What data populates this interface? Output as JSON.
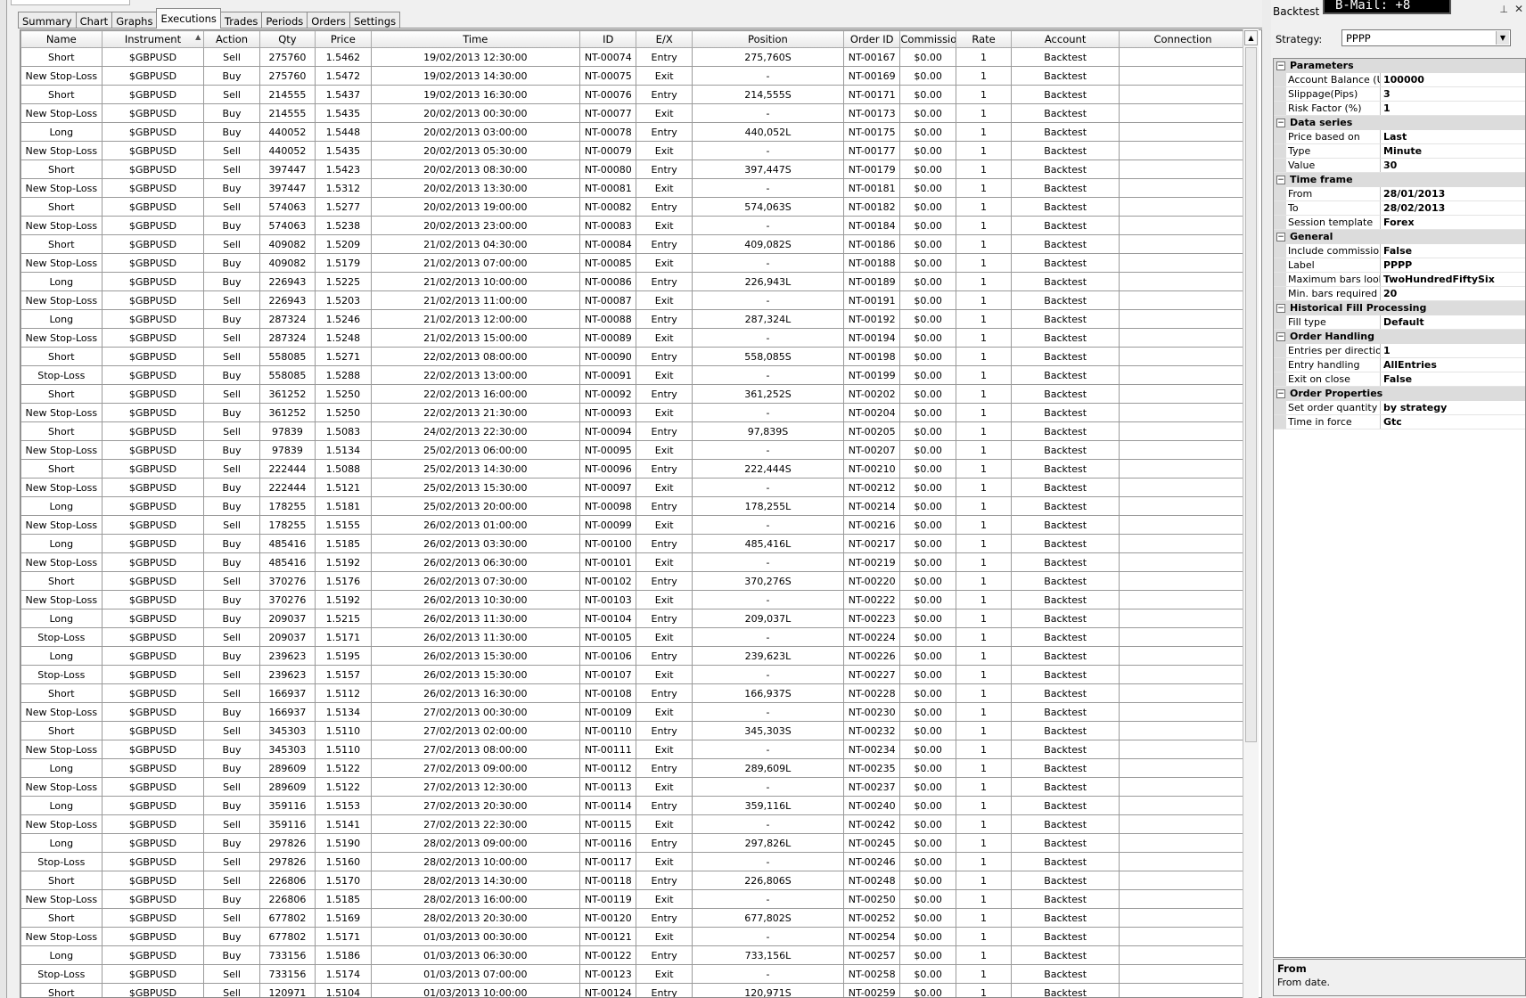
{
  "tabs": [
    "Summary",
    "Chart",
    "Graphs",
    "Executions",
    "Trades",
    "Periods",
    "Orders",
    "Settings"
  ],
  "active_tab": "Executions",
  "columns": [
    {
      "label": "Name",
      "w": 90
    },
    {
      "label": "Instrument",
      "w": 114
    },
    {
      "label": "Action",
      "w": 62
    },
    {
      "label": "Qty",
      "w": 62
    },
    {
      "label": "Price",
      "w": 62
    },
    {
      "label": "Time",
      "w": 233
    },
    {
      "label": "ID",
      "w": 63
    },
    {
      "label": "E/X",
      "w": 62
    },
    {
      "label": "Position",
      "w": 169
    },
    {
      "label": "Order ID",
      "w": 63
    },
    {
      "label": "Commissio",
      "w": 62
    },
    {
      "label": "Rate",
      "w": 62
    },
    {
      "label": "Account",
      "w": 120
    },
    {
      "label": "Connection",
      "w": 142
    }
  ],
  "rows": [
    [
      "Short",
      "$GBPUSD",
      "Sell",
      "275760",
      "1.5462",
      "19/02/2013 12:30:00",
      "NT-00074",
      "Entry",
      "275,760S",
      "NT-00167",
      "$0.00",
      "1",
      "Backtest",
      ""
    ],
    [
      "New Stop-Loss",
      "$GBPUSD",
      "Buy",
      "275760",
      "1.5472",
      "19/02/2013 14:30:00",
      "NT-00075",
      "Exit",
      "-",
      "NT-00169",
      "$0.00",
      "1",
      "Backtest",
      ""
    ],
    [
      "Short",
      "$GBPUSD",
      "Sell",
      "214555",
      "1.5437",
      "19/02/2013 16:30:00",
      "NT-00076",
      "Entry",
      "214,555S",
      "NT-00171",
      "$0.00",
      "1",
      "Backtest",
      ""
    ],
    [
      "New Stop-Loss",
      "$GBPUSD",
      "Buy",
      "214555",
      "1.5435",
      "20/02/2013 00:30:00",
      "NT-00077",
      "Exit",
      "-",
      "NT-00173",
      "$0.00",
      "1",
      "Backtest",
      ""
    ],
    [
      "Long",
      "$GBPUSD",
      "Buy",
      "440052",
      "1.5448",
      "20/02/2013 03:00:00",
      "NT-00078",
      "Entry",
      "440,052L",
      "NT-00175",
      "$0.00",
      "1",
      "Backtest",
      ""
    ],
    [
      "New Stop-Loss",
      "$GBPUSD",
      "Sell",
      "440052",
      "1.5435",
      "20/02/2013 05:30:00",
      "NT-00079",
      "Exit",
      "-",
      "NT-00177",
      "$0.00",
      "1",
      "Backtest",
      ""
    ],
    [
      "Short",
      "$GBPUSD",
      "Sell",
      "397447",
      "1.5423",
      "20/02/2013 08:30:00",
      "NT-00080",
      "Entry",
      "397,447S",
      "NT-00179",
      "$0.00",
      "1",
      "Backtest",
      ""
    ],
    [
      "New Stop-Loss",
      "$GBPUSD",
      "Buy",
      "397447",
      "1.5312",
      "20/02/2013 13:30:00",
      "NT-00081",
      "Exit",
      "-",
      "NT-00181",
      "$0.00",
      "1",
      "Backtest",
      ""
    ],
    [
      "Short",
      "$GBPUSD",
      "Sell",
      "574063",
      "1.5277",
      "20/02/2013 19:00:00",
      "NT-00082",
      "Entry",
      "574,063S",
      "NT-00182",
      "$0.00",
      "1",
      "Backtest",
      ""
    ],
    [
      "New Stop-Loss",
      "$GBPUSD",
      "Buy",
      "574063",
      "1.5238",
      "20/02/2013 23:00:00",
      "NT-00083",
      "Exit",
      "-",
      "NT-00184",
      "$0.00",
      "1",
      "Backtest",
      ""
    ],
    [
      "Short",
      "$GBPUSD",
      "Sell",
      "409082",
      "1.5209",
      "21/02/2013 04:30:00",
      "NT-00084",
      "Entry",
      "409,082S",
      "NT-00186",
      "$0.00",
      "1",
      "Backtest",
      ""
    ],
    [
      "New Stop-Loss",
      "$GBPUSD",
      "Buy",
      "409082",
      "1.5179",
      "21/02/2013 07:00:00",
      "NT-00085",
      "Exit",
      "-",
      "NT-00188",
      "$0.00",
      "1",
      "Backtest",
      ""
    ],
    [
      "Long",
      "$GBPUSD",
      "Buy",
      "226943",
      "1.5225",
      "21/02/2013 10:00:00",
      "NT-00086",
      "Entry",
      "226,943L",
      "NT-00189",
      "$0.00",
      "1",
      "Backtest",
      ""
    ],
    [
      "New Stop-Loss",
      "$GBPUSD",
      "Sell",
      "226943",
      "1.5203",
      "21/02/2013 11:00:00",
      "NT-00087",
      "Exit",
      "-",
      "NT-00191",
      "$0.00",
      "1",
      "Backtest",
      ""
    ],
    [
      "Long",
      "$GBPUSD",
      "Buy",
      "287324",
      "1.5246",
      "21/02/2013 12:00:00",
      "NT-00088",
      "Entry",
      "287,324L",
      "NT-00192",
      "$0.00",
      "1",
      "Backtest",
      ""
    ],
    [
      "New Stop-Loss",
      "$GBPUSD",
      "Sell",
      "287324",
      "1.5248",
      "21/02/2013 15:00:00",
      "NT-00089",
      "Exit",
      "-",
      "NT-00194",
      "$0.00",
      "1",
      "Backtest",
      ""
    ],
    [
      "Short",
      "$GBPUSD",
      "Sell",
      "558085",
      "1.5271",
      "22/02/2013 08:00:00",
      "NT-00090",
      "Entry",
      "558,085S",
      "NT-00198",
      "$0.00",
      "1",
      "Backtest",
      ""
    ],
    [
      "Stop-Loss",
      "$GBPUSD",
      "Buy",
      "558085",
      "1.5288",
      "22/02/2013 13:00:00",
      "NT-00091",
      "Exit",
      "-",
      "NT-00199",
      "$0.00",
      "1",
      "Backtest",
      ""
    ],
    [
      "Short",
      "$GBPUSD",
      "Sell",
      "361252",
      "1.5250",
      "22/02/2013 16:00:00",
      "NT-00092",
      "Entry",
      "361,252S",
      "NT-00202",
      "$0.00",
      "1",
      "Backtest",
      ""
    ],
    [
      "New Stop-Loss",
      "$GBPUSD",
      "Buy",
      "361252",
      "1.5250",
      "22/02/2013 21:30:00",
      "NT-00093",
      "Exit",
      "-",
      "NT-00204",
      "$0.00",
      "1",
      "Backtest",
      ""
    ],
    [
      "Short",
      "$GBPUSD",
      "Sell",
      "97839",
      "1.5083",
      "24/02/2013 22:30:00",
      "NT-00094",
      "Entry",
      "97,839S",
      "NT-00205",
      "$0.00",
      "1",
      "Backtest",
      ""
    ],
    [
      "New Stop-Loss",
      "$GBPUSD",
      "Buy",
      "97839",
      "1.5134",
      "25/02/2013 06:00:00",
      "NT-00095",
      "Exit",
      "-",
      "NT-00207",
      "$0.00",
      "1",
      "Backtest",
      ""
    ],
    [
      "Short",
      "$GBPUSD",
      "Sell",
      "222444",
      "1.5088",
      "25/02/2013 14:30:00",
      "NT-00096",
      "Entry",
      "222,444S",
      "NT-00210",
      "$0.00",
      "1",
      "Backtest",
      ""
    ],
    [
      "New Stop-Loss",
      "$GBPUSD",
      "Buy",
      "222444",
      "1.5121",
      "25/02/2013 15:30:00",
      "NT-00097",
      "Exit",
      "-",
      "NT-00212",
      "$0.00",
      "1",
      "Backtest",
      ""
    ],
    [
      "Long",
      "$GBPUSD",
      "Buy",
      "178255",
      "1.5181",
      "25/02/2013 20:00:00",
      "NT-00098",
      "Entry",
      "178,255L",
      "NT-00214",
      "$0.00",
      "1",
      "Backtest",
      ""
    ],
    [
      "New Stop-Loss",
      "$GBPUSD",
      "Sell",
      "178255",
      "1.5155",
      "26/02/2013 01:00:00",
      "NT-00099",
      "Exit",
      "-",
      "NT-00216",
      "$0.00",
      "1",
      "Backtest",
      ""
    ],
    [
      "Long",
      "$GBPUSD",
      "Buy",
      "485416",
      "1.5185",
      "26/02/2013 03:30:00",
      "NT-00100",
      "Entry",
      "485,416L",
      "NT-00217",
      "$0.00",
      "1",
      "Backtest",
      ""
    ],
    [
      "New Stop-Loss",
      "$GBPUSD",
      "Buy",
      "485416",
      "1.5192",
      "26/02/2013 06:30:00",
      "NT-00101",
      "Exit",
      "-",
      "NT-00219",
      "$0.00",
      "1",
      "Backtest",
      ""
    ],
    [
      "Short",
      "$GBPUSD",
      "Sell",
      "370276",
      "1.5176",
      "26/02/2013 07:30:00",
      "NT-00102",
      "Entry",
      "370,276S",
      "NT-00220",
      "$0.00",
      "1",
      "Backtest",
      ""
    ],
    [
      "New Stop-Loss",
      "$GBPUSD",
      "Buy",
      "370276",
      "1.5192",
      "26/02/2013 10:30:00",
      "NT-00103",
      "Exit",
      "-",
      "NT-00222",
      "$0.00",
      "1",
      "Backtest",
      ""
    ],
    [
      "Long",
      "$GBPUSD",
      "Buy",
      "209037",
      "1.5215",
      "26/02/2013 11:30:00",
      "NT-00104",
      "Entry",
      "209,037L",
      "NT-00223",
      "$0.00",
      "1",
      "Backtest",
      ""
    ],
    [
      "Stop-Loss",
      "$GBPUSD",
      "Sell",
      "209037",
      "1.5171",
      "26/02/2013 11:30:00",
      "NT-00105",
      "Exit",
      "-",
      "NT-00224",
      "$0.00",
      "1",
      "Backtest",
      ""
    ],
    [
      "Long",
      "$GBPUSD",
      "Buy",
      "239623",
      "1.5195",
      "26/02/2013 15:30:00",
      "NT-00106",
      "Entry",
      "239,623L",
      "NT-00226",
      "$0.00",
      "1",
      "Backtest",
      ""
    ],
    [
      "Stop-Loss",
      "$GBPUSD",
      "Sell",
      "239623",
      "1.5157",
      "26/02/2013 15:30:00",
      "NT-00107",
      "Exit",
      "-",
      "NT-00227",
      "$0.00",
      "1",
      "Backtest",
      ""
    ],
    [
      "Short",
      "$GBPUSD",
      "Sell",
      "166937",
      "1.5112",
      "26/02/2013 16:30:00",
      "NT-00108",
      "Entry",
      "166,937S",
      "NT-00228",
      "$0.00",
      "1",
      "Backtest",
      ""
    ],
    [
      "New Stop-Loss",
      "$GBPUSD",
      "Buy",
      "166937",
      "1.5134",
      "27/02/2013 00:30:00",
      "NT-00109",
      "Exit",
      "-",
      "NT-00230",
      "$0.00",
      "1",
      "Backtest",
      ""
    ],
    [
      "Short",
      "$GBPUSD",
      "Sell",
      "345303",
      "1.5110",
      "27/02/2013 02:00:00",
      "NT-00110",
      "Entry",
      "345,303S",
      "NT-00232",
      "$0.00",
      "1",
      "Backtest",
      ""
    ],
    [
      "New Stop-Loss",
      "$GBPUSD",
      "Buy",
      "345303",
      "1.5110",
      "27/02/2013 08:00:00",
      "NT-00111",
      "Exit",
      "-",
      "NT-00234",
      "$0.00",
      "1",
      "Backtest",
      ""
    ],
    [
      "Long",
      "$GBPUSD",
      "Buy",
      "289609",
      "1.5122",
      "27/02/2013 09:00:00",
      "NT-00112",
      "Entry",
      "289,609L",
      "NT-00235",
      "$0.00",
      "1",
      "Backtest",
      ""
    ],
    [
      "New Stop-Loss",
      "$GBPUSD",
      "Sell",
      "289609",
      "1.5122",
      "27/02/2013 12:30:00",
      "NT-00113",
      "Exit",
      "-",
      "NT-00237",
      "$0.00",
      "1",
      "Backtest",
      ""
    ],
    [
      "Long",
      "$GBPUSD",
      "Buy",
      "359116",
      "1.5153",
      "27/02/2013 20:30:00",
      "NT-00114",
      "Entry",
      "359,116L",
      "NT-00240",
      "$0.00",
      "1",
      "Backtest",
      ""
    ],
    [
      "New Stop-Loss",
      "$GBPUSD",
      "Sell",
      "359116",
      "1.5141",
      "27/02/2013 22:30:00",
      "NT-00115",
      "Exit",
      "-",
      "NT-00242",
      "$0.00",
      "1",
      "Backtest",
      ""
    ],
    [
      "Long",
      "$GBPUSD",
      "Buy",
      "297826",
      "1.5190",
      "28/02/2013 09:00:00",
      "NT-00116",
      "Entry",
      "297,826L",
      "NT-00245",
      "$0.00",
      "1",
      "Backtest",
      ""
    ],
    [
      "Stop-Loss",
      "$GBPUSD",
      "Sell",
      "297826",
      "1.5160",
      "28/02/2013 10:00:00",
      "NT-00117",
      "Exit",
      "-",
      "NT-00246",
      "$0.00",
      "1",
      "Backtest",
      ""
    ],
    [
      "Short",
      "$GBPUSD",
      "Sell",
      "226806",
      "1.5170",
      "28/02/2013 14:30:00",
      "NT-00118",
      "Entry",
      "226,806S",
      "NT-00248",
      "$0.00",
      "1",
      "Backtest",
      ""
    ],
    [
      "New Stop-Loss",
      "$GBPUSD",
      "Buy",
      "226806",
      "1.5185",
      "28/02/2013 16:00:00",
      "NT-00119",
      "Exit",
      "-",
      "NT-00250",
      "$0.00",
      "1",
      "Backtest",
      ""
    ],
    [
      "Short",
      "$GBPUSD",
      "Sell",
      "677802",
      "1.5169",
      "28/02/2013 20:30:00",
      "NT-00120",
      "Entry",
      "677,802S",
      "NT-00252",
      "$0.00",
      "1",
      "Backtest",
      ""
    ],
    [
      "New Stop-Loss",
      "$GBPUSD",
      "Buy",
      "677802",
      "1.5171",
      "01/03/2013 00:30:00",
      "NT-00121",
      "Exit",
      "-",
      "NT-00254",
      "$0.00",
      "1",
      "Backtest",
      ""
    ],
    [
      "Long",
      "$GBPUSD",
      "Buy",
      "733156",
      "1.5186",
      "01/03/2013 06:30:00",
      "NT-00122",
      "Entry",
      "733,156L",
      "NT-00257",
      "$0.00",
      "1",
      "Backtest",
      ""
    ],
    [
      "Stop-Loss",
      "$GBPUSD",
      "Sell",
      "733156",
      "1.5174",
      "01/03/2013 07:00:00",
      "NT-00123",
      "Exit",
      "-",
      "NT-00258",
      "$0.00",
      "1",
      "Backtest",
      ""
    ],
    [
      "Short",
      "$GBPUSD",
      "Sell",
      "120971",
      "1.5104",
      "01/03/2013 10:00:00",
      "NT-00124",
      "Entry",
      "120,971S",
      "NT-00259",
      "$0.00",
      "1",
      "Backtest",
      ""
    ]
  ],
  "panel": {
    "title": "Backtest",
    "bmail": "B-Mail: +8",
    "strategy_label": "Strategy:",
    "strategy_value": "PPPP",
    "categories": [
      {
        "name": "Parameters",
        "props": [
          {
            "name": "Account Balance (USD)",
            "value": "100000"
          },
          {
            "name": "Slippage(Pips)",
            "value": "3"
          },
          {
            "name": "Risk Factor (%)",
            "value": "1"
          }
        ]
      },
      {
        "name": "Data series",
        "props": [
          {
            "name": "Price based on",
            "value": "Last"
          },
          {
            "name": "Type",
            "value": "Minute"
          },
          {
            "name": "Value",
            "value": "30"
          }
        ]
      },
      {
        "name": "Time frame",
        "props": [
          {
            "name": "From",
            "value": "28/01/2013"
          },
          {
            "name": "To",
            "value": "28/02/2013"
          },
          {
            "name": "Session template",
            "value": "Forex"
          }
        ]
      },
      {
        "name": "General",
        "props": [
          {
            "name": "Include commission",
            "value": "False"
          },
          {
            "name": "Label",
            "value": "PPPP"
          },
          {
            "name": "Maximum bars look back",
            "value": "TwoHundredFiftySix"
          },
          {
            "name": "Min. bars required",
            "value": "20"
          }
        ]
      },
      {
        "name": "Historical Fill Processing",
        "props": [
          {
            "name": "Fill type",
            "value": "Default"
          }
        ]
      },
      {
        "name": "Order Handling",
        "props": [
          {
            "name": "Entries per direction",
            "value": "1"
          },
          {
            "name": "Entry handling",
            "value": "AllEntries"
          },
          {
            "name": "Exit on close",
            "value": "False"
          }
        ]
      },
      {
        "name": "Order Properties",
        "props": [
          {
            "name": "Set order quantity",
            "value": "by strategy"
          },
          {
            "name": "Time in force",
            "value": "Gtc"
          }
        ]
      }
    ],
    "description_title": "From",
    "description_text": "From date."
  }
}
